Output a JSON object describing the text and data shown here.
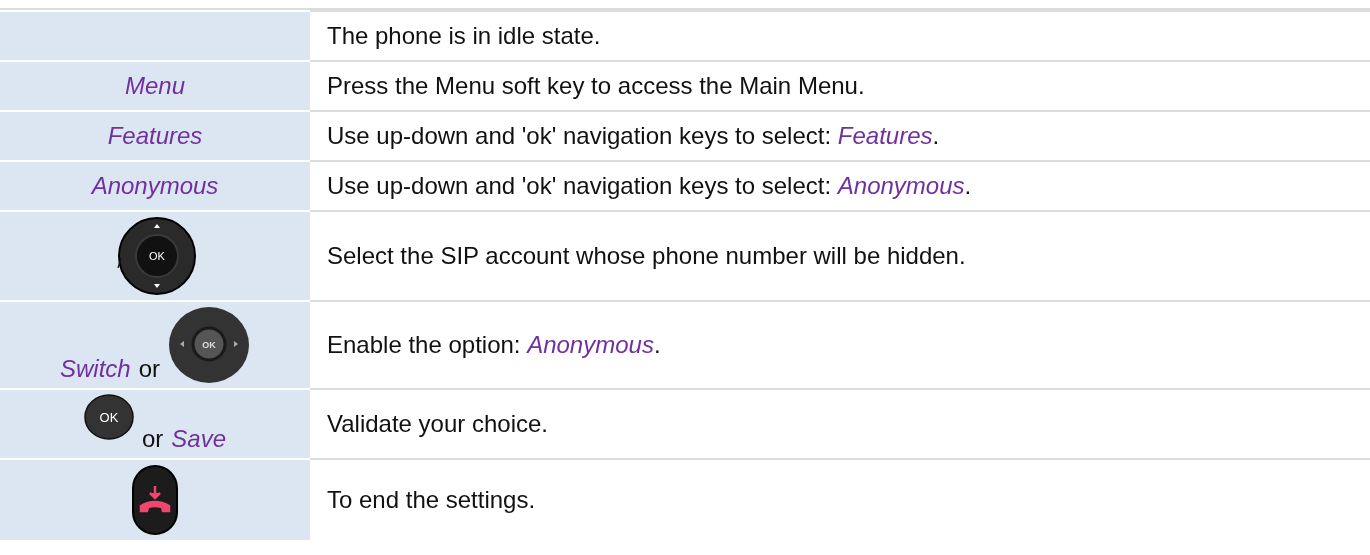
{
  "rows": [
    {
      "action": [],
      "description": "The phone is in idle state."
    },
    {
      "action": [
        {
          "kind": "softkey",
          "text": "Menu"
        }
      ],
      "description": "Press the Menu soft key to access the Main Menu."
    },
    {
      "action": [
        {
          "kind": "softkey",
          "text": "Features"
        }
      ],
      "description": "Use up-down and 'ok' navigation keys to select: *Features*."
    },
    {
      "action": [
        {
          "kind": "softkey",
          "text": "Anonymous"
        }
      ],
      "description": "Use up-down and 'ok' navigation keys to select: *Anonymous*."
    },
    {
      "action": [
        {
          "kind": "nav_updown",
          "label": "OK"
        }
      ],
      "description": "Select the SIP account whose phone number will be hidden."
    },
    {
      "action": [
        {
          "kind": "softkey",
          "text": "Switch"
        },
        {
          "kind": "word",
          "text": "or"
        },
        {
          "kind": "nav_leftright",
          "label": "OK"
        }
      ],
      "description": "Enable the option: *Anonymous*."
    },
    {
      "action": [
        {
          "kind": "ok_key",
          "label": "OK"
        },
        {
          "kind": "word",
          "text": "or"
        },
        {
          "kind": "softkey",
          "text": "Save"
        }
      ],
      "description": "Validate your choice."
    },
    {
      "action": [
        {
          "kind": "end_key"
        }
      ],
      "description": "To end the settings."
    }
  ]
}
